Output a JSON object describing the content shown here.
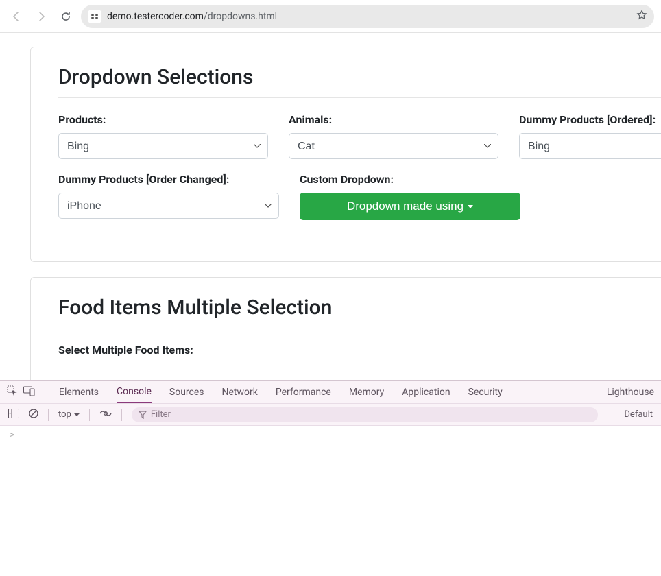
{
  "browser": {
    "url_domain": "demo.testercoder.com",
    "url_path": "/dropdowns.html"
  },
  "section1": {
    "title": "Dropdown Selections",
    "products_label": "Products:",
    "products_value": "Bing",
    "animals_label": "Animals:",
    "animals_value": "Cat",
    "dummy_ordered_label": "Dummy Products [Ordered]:",
    "dummy_ordered_value": "Bing",
    "dummy_changed_label": "Dummy Products [Order Changed]:",
    "dummy_changed_value": "iPhone",
    "custom_label": "Custom Dropdown:",
    "custom_button": "Dropdown made using"
  },
  "section2": {
    "title": "Food Items Multiple Selection",
    "multi_label": "Select Multiple Food Items:"
  },
  "devtools": {
    "tabs": {
      "elements": "Elements",
      "console": "Console",
      "sources": "Sources",
      "network": "Network",
      "performance": "Performance",
      "memory": "Memory",
      "application": "Application",
      "security": "Security",
      "lighthouse": "Lighthouse"
    },
    "top_label": "top",
    "filter_placeholder": "Filter",
    "levels_label": "Default",
    "prompt": ">"
  }
}
